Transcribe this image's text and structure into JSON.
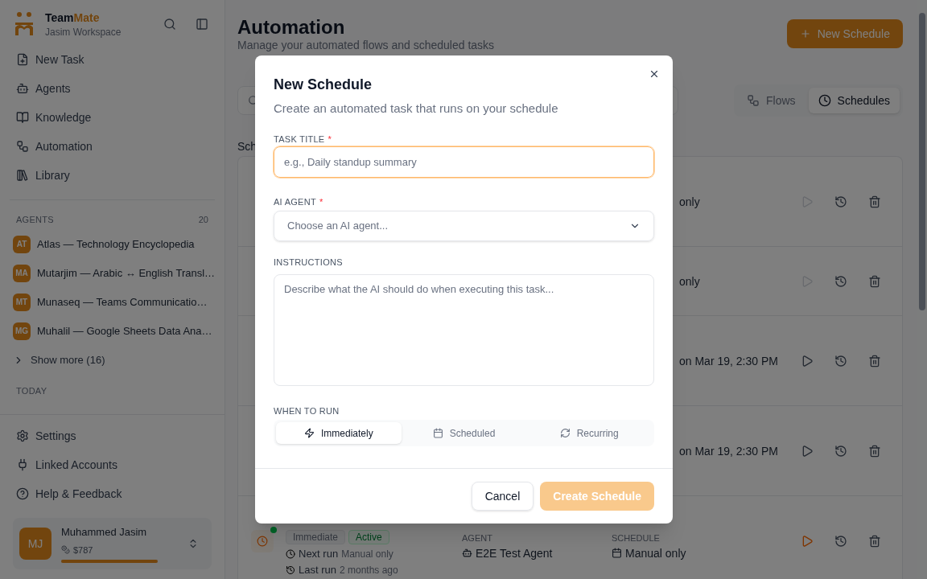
{
  "sidebar": {
    "brand": {
      "name_a": "Team",
      "name_b": "Mate",
      "workspace": "Jasim Workspace"
    },
    "nav": [
      {
        "label": "New Task"
      },
      {
        "label": "Agents"
      },
      {
        "label": "Knowledge"
      },
      {
        "label": "Automation"
      },
      {
        "label": "Library"
      }
    ],
    "agents_heading": "AGENTS",
    "agents_count": "20",
    "agents": [
      {
        "initials": "AT",
        "name": "Atlas — Technology Encyclopedia"
      },
      {
        "initials": "MA",
        "name": "Mutarjim — Arabic ↔ English Transl…"
      },
      {
        "initials": "MT",
        "name": "Munaseq — Teams Communicatio…"
      },
      {
        "initials": "MG",
        "name": "Muhalil — Google Sheets Data Ana…"
      }
    ],
    "show_more": "Show more (16)",
    "today_heading": "TODAY",
    "bottom_nav": [
      {
        "label": "Settings"
      },
      {
        "label": "Linked Accounts"
      },
      {
        "label": "Help & Feedback"
      }
    ],
    "user": {
      "initials": "MJ",
      "name": "Muhammed Jasim",
      "credits": "$787",
      "level": 1
    }
  },
  "main": {
    "title": "Automation",
    "subtitle": "Manage your automated flows and scheduled tasks",
    "new_button": "New Schedule",
    "view_tabs": [
      {
        "label": "Flows",
        "selected": false
      },
      {
        "label": "Schedules",
        "selected": true
      }
    ],
    "section_label": "Sch",
    "rows": [
      {
        "schedule_fragment": "only",
        "run_disabled": true
      },
      {
        "schedule_fragment": "only",
        "run_disabled": true
      },
      {
        "schedule_fragment": "on Mar 19, 2:30 PM",
        "run_disabled": false
      },
      {
        "schedule_fragment": "on Mar 19, 2:30 PM",
        "run_disabled": false
      }
    ],
    "last_row": {
      "tags": [
        {
          "label": "Immediate",
          "kind": "neutral"
        },
        {
          "label": "Active",
          "kind": "success"
        }
      ],
      "next_label": "Next run",
      "next_value": "Manual only",
      "last_label": "Last run",
      "last_value": "2 months ago",
      "agent_heading": "AGENT",
      "agent": "E2E Test Agent",
      "schedule_heading": "SCHEDULE",
      "schedule": "Manual only",
      "run_highlighted": true
    }
  },
  "dialog": {
    "title": "New Schedule",
    "description": "Create an automated task that runs on your schedule",
    "task": {
      "label": "TASK TITLE",
      "required_mark": "*",
      "placeholder": "e.g., Daily standup summary"
    },
    "agent": {
      "label": "AI AGENT",
      "required_mark": "*",
      "placeholder": "Choose an AI agent..."
    },
    "instructions": {
      "label": "INSTRUCTIONS",
      "placeholder": "Describe what the AI should do when executing this task..."
    },
    "when_label": "WHEN TO RUN",
    "when_options": [
      {
        "label": "Immediately",
        "selected": true
      },
      {
        "label": "Scheduled",
        "selected": false
      },
      {
        "label": "Recurring",
        "selected": false
      }
    ],
    "cancel": "Cancel",
    "submit": "Create Schedule",
    "submit_disabled": true
  }
}
